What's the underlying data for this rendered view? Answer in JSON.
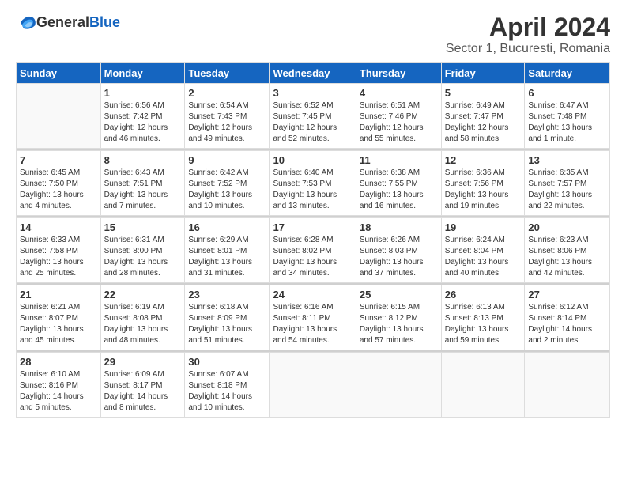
{
  "logo": {
    "general": "General",
    "blue": "Blue"
  },
  "title": "April 2024",
  "subtitle": "Sector 1, Bucuresti, Romania",
  "headers": [
    "Sunday",
    "Monday",
    "Tuesday",
    "Wednesday",
    "Thursday",
    "Friday",
    "Saturday"
  ],
  "weeks": [
    [
      {
        "day": "",
        "info": ""
      },
      {
        "day": "1",
        "info": "Sunrise: 6:56 AM\nSunset: 7:42 PM\nDaylight: 12 hours\nand 46 minutes."
      },
      {
        "day": "2",
        "info": "Sunrise: 6:54 AM\nSunset: 7:43 PM\nDaylight: 12 hours\nand 49 minutes."
      },
      {
        "day": "3",
        "info": "Sunrise: 6:52 AM\nSunset: 7:45 PM\nDaylight: 12 hours\nand 52 minutes."
      },
      {
        "day": "4",
        "info": "Sunrise: 6:51 AM\nSunset: 7:46 PM\nDaylight: 12 hours\nand 55 minutes."
      },
      {
        "day": "5",
        "info": "Sunrise: 6:49 AM\nSunset: 7:47 PM\nDaylight: 12 hours\nand 58 minutes."
      },
      {
        "day": "6",
        "info": "Sunrise: 6:47 AM\nSunset: 7:48 PM\nDaylight: 13 hours\nand 1 minute."
      }
    ],
    [
      {
        "day": "7",
        "info": "Sunrise: 6:45 AM\nSunset: 7:50 PM\nDaylight: 13 hours\nand 4 minutes."
      },
      {
        "day": "8",
        "info": "Sunrise: 6:43 AM\nSunset: 7:51 PM\nDaylight: 13 hours\nand 7 minutes."
      },
      {
        "day": "9",
        "info": "Sunrise: 6:42 AM\nSunset: 7:52 PM\nDaylight: 13 hours\nand 10 minutes."
      },
      {
        "day": "10",
        "info": "Sunrise: 6:40 AM\nSunset: 7:53 PM\nDaylight: 13 hours\nand 13 minutes."
      },
      {
        "day": "11",
        "info": "Sunrise: 6:38 AM\nSunset: 7:55 PM\nDaylight: 13 hours\nand 16 minutes."
      },
      {
        "day": "12",
        "info": "Sunrise: 6:36 AM\nSunset: 7:56 PM\nDaylight: 13 hours\nand 19 minutes."
      },
      {
        "day": "13",
        "info": "Sunrise: 6:35 AM\nSunset: 7:57 PM\nDaylight: 13 hours\nand 22 minutes."
      }
    ],
    [
      {
        "day": "14",
        "info": "Sunrise: 6:33 AM\nSunset: 7:58 PM\nDaylight: 13 hours\nand 25 minutes."
      },
      {
        "day": "15",
        "info": "Sunrise: 6:31 AM\nSunset: 8:00 PM\nDaylight: 13 hours\nand 28 minutes."
      },
      {
        "day": "16",
        "info": "Sunrise: 6:29 AM\nSunset: 8:01 PM\nDaylight: 13 hours\nand 31 minutes."
      },
      {
        "day": "17",
        "info": "Sunrise: 6:28 AM\nSunset: 8:02 PM\nDaylight: 13 hours\nand 34 minutes."
      },
      {
        "day": "18",
        "info": "Sunrise: 6:26 AM\nSunset: 8:03 PM\nDaylight: 13 hours\nand 37 minutes."
      },
      {
        "day": "19",
        "info": "Sunrise: 6:24 AM\nSunset: 8:04 PM\nDaylight: 13 hours\nand 40 minutes."
      },
      {
        "day": "20",
        "info": "Sunrise: 6:23 AM\nSunset: 8:06 PM\nDaylight: 13 hours\nand 42 minutes."
      }
    ],
    [
      {
        "day": "21",
        "info": "Sunrise: 6:21 AM\nSunset: 8:07 PM\nDaylight: 13 hours\nand 45 minutes."
      },
      {
        "day": "22",
        "info": "Sunrise: 6:19 AM\nSunset: 8:08 PM\nDaylight: 13 hours\nand 48 minutes."
      },
      {
        "day": "23",
        "info": "Sunrise: 6:18 AM\nSunset: 8:09 PM\nDaylight: 13 hours\nand 51 minutes."
      },
      {
        "day": "24",
        "info": "Sunrise: 6:16 AM\nSunset: 8:11 PM\nDaylight: 13 hours\nand 54 minutes."
      },
      {
        "day": "25",
        "info": "Sunrise: 6:15 AM\nSunset: 8:12 PM\nDaylight: 13 hours\nand 57 minutes."
      },
      {
        "day": "26",
        "info": "Sunrise: 6:13 AM\nSunset: 8:13 PM\nDaylight: 13 hours\nand 59 minutes."
      },
      {
        "day": "27",
        "info": "Sunrise: 6:12 AM\nSunset: 8:14 PM\nDaylight: 14 hours\nand 2 minutes."
      }
    ],
    [
      {
        "day": "28",
        "info": "Sunrise: 6:10 AM\nSunset: 8:16 PM\nDaylight: 14 hours\nand 5 minutes."
      },
      {
        "day": "29",
        "info": "Sunrise: 6:09 AM\nSunset: 8:17 PM\nDaylight: 14 hours\nand 8 minutes."
      },
      {
        "day": "30",
        "info": "Sunrise: 6:07 AM\nSunset: 8:18 PM\nDaylight: 14 hours\nand 10 minutes."
      },
      {
        "day": "",
        "info": ""
      },
      {
        "day": "",
        "info": ""
      },
      {
        "day": "",
        "info": ""
      },
      {
        "day": "",
        "info": ""
      }
    ]
  ]
}
